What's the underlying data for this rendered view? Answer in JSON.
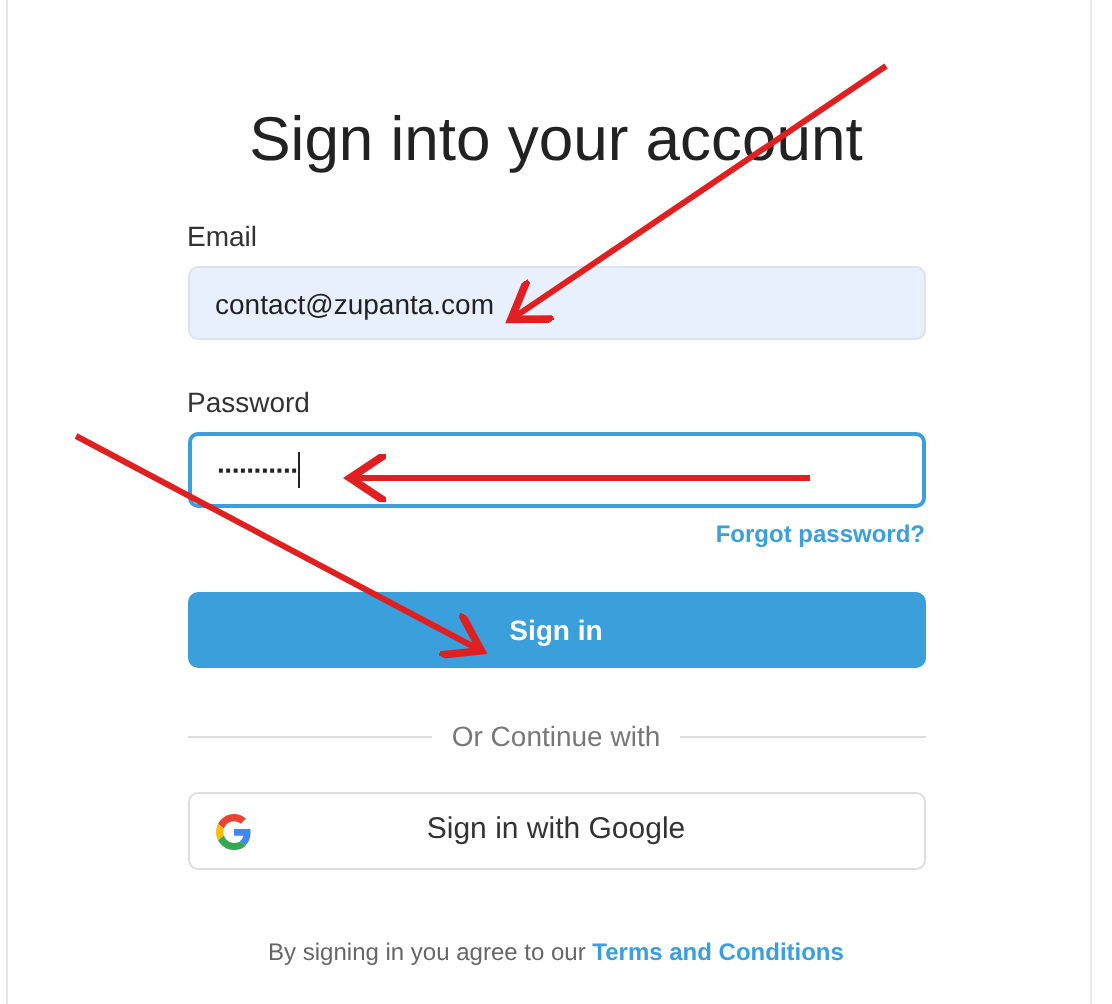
{
  "title": "Sign into your account",
  "email": {
    "label": "Email",
    "value": "contact@zupanta.com",
    "autofilled": true
  },
  "password": {
    "label": "Password",
    "value": "···········",
    "focused": true
  },
  "forgot_link": "Forgot password?",
  "sign_in_button": "Sign in",
  "divider_text": "Or Continue with",
  "google_button": "Sign in with Google",
  "footer": {
    "text": "By signing in you agree to our",
    "link": "Terms and Conditions"
  }
}
